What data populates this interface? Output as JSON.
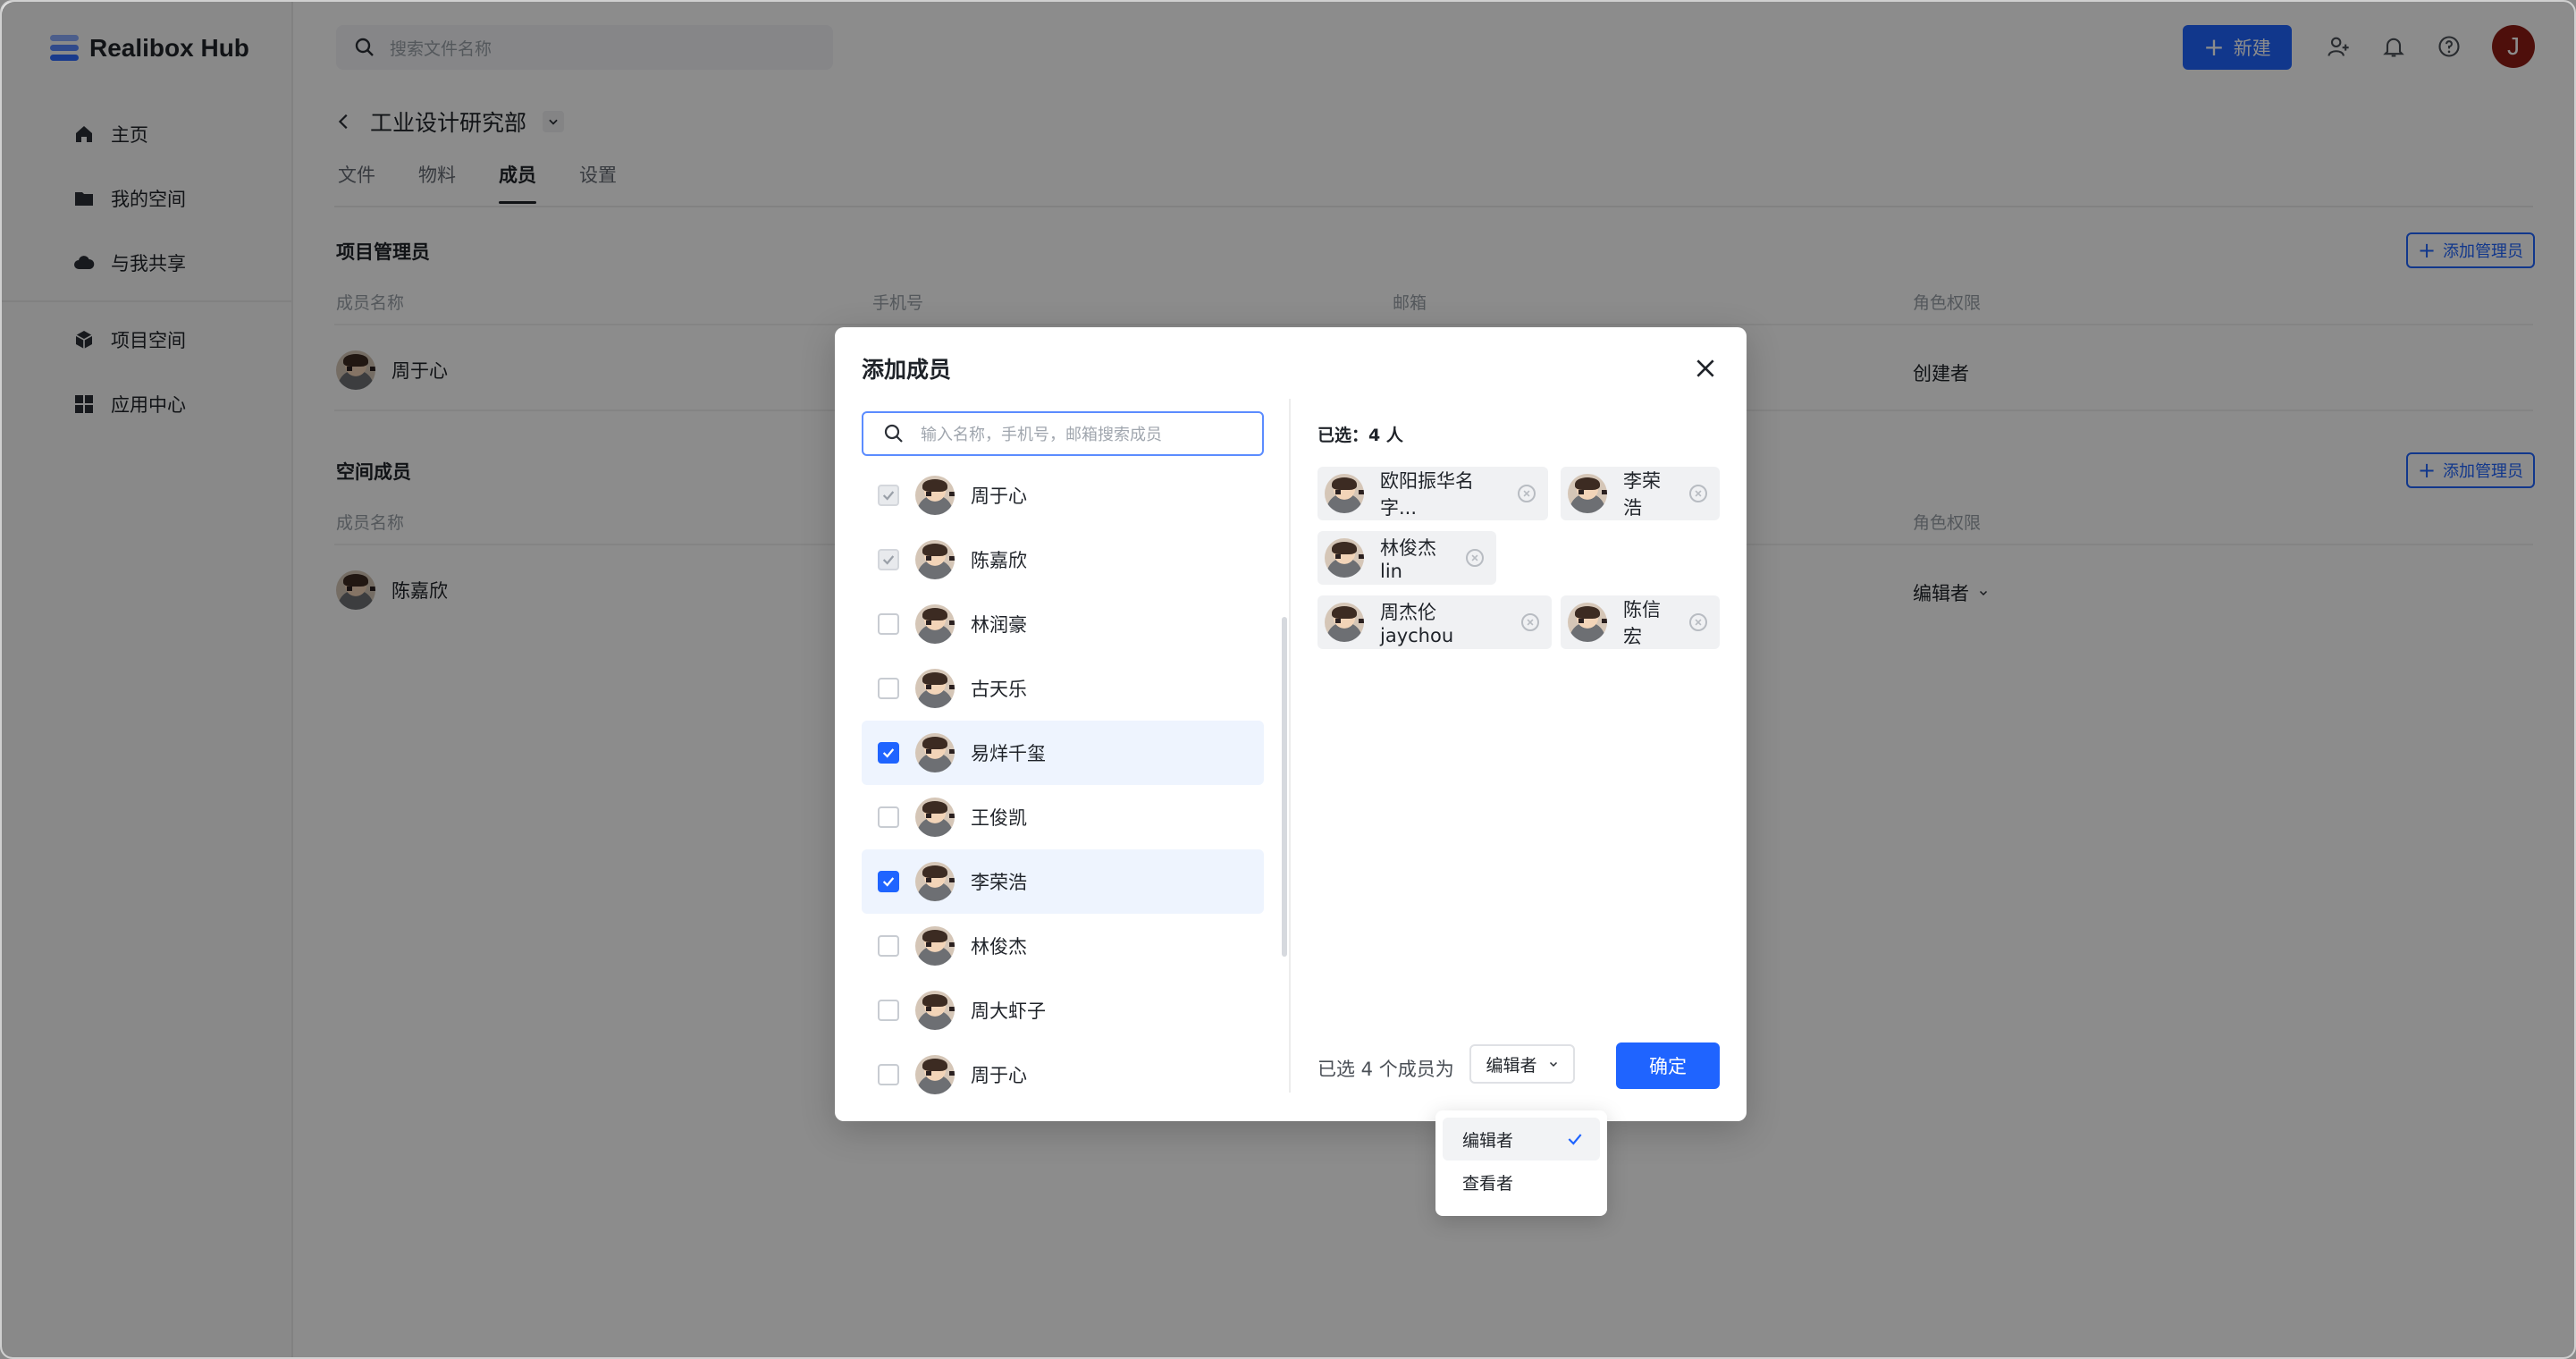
{
  "app": {
    "brand": "Realibox Hub"
  },
  "sidebar": {
    "items": [
      {
        "label": "主页",
        "icon": "home-icon"
      },
      {
        "label": "我的空间",
        "icon": "folder-icon"
      },
      {
        "label": "与我共享",
        "icon": "cloud-icon"
      },
      {
        "label": "项目空间",
        "icon": "cube-icon"
      },
      {
        "label": "应用中心",
        "icon": "grid-icon"
      }
    ]
  },
  "topbar": {
    "search_placeholder": "搜索文件名称",
    "new_button": "新建",
    "avatar_initial": "J"
  },
  "page": {
    "title": "工业设计研究部",
    "tabs": [
      "文件",
      "物料",
      "成员",
      "设置"
    ],
    "active_tab": "成员",
    "admins": {
      "title": "项目管理员",
      "add_button": "添加管理员",
      "columns": [
        "成员名称",
        "手机号",
        "邮箱",
        "角色权限"
      ],
      "rows": [
        {
          "name": "周于心",
          "role": "创建者"
        }
      ]
    },
    "members": {
      "title": "空间成员",
      "add_button": "添加管理员",
      "columns": [
        "成员名称",
        "角色权限"
      ],
      "rows": [
        {
          "name": "陈嘉欣",
          "role": "编辑者"
        }
      ]
    }
  },
  "modal": {
    "title": "添加成员",
    "search_placeholder": "输入名称，手机号，邮箱搜索成员",
    "list": [
      {
        "name": "周于心",
        "state": "disabled"
      },
      {
        "name": "陈嘉欣",
        "state": "disabled"
      },
      {
        "name": "林润豪",
        "state": "off"
      },
      {
        "name": "古天乐",
        "state": "off"
      },
      {
        "name": "易烊千玺",
        "state": "on"
      },
      {
        "name": "王俊凯",
        "state": "off"
      },
      {
        "name": "李荣浩",
        "state": "on"
      },
      {
        "name": "林俊杰",
        "state": "off"
      },
      {
        "name": "周大虾子",
        "state": "off"
      },
      {
        "name": "周于心",
        "state": "off"
      }
    ],
    "selected_title": "已选：4 人",
    "chips": [
      "欧阳振华名字...",
      "李荣浩",
      "林俊杰lin",
      "周杰伦 jaychou",
      "陈信宏"
    ],
    "footer_text": "已选 4 个成员为",
    "role_value": "编辑者",
    "confirm": "确定"
  },
  "dropdown": {
    "options": [
      {
        "label": "编辑者",
        "checked": true
      },
      {
        "label": "查看者",
        "checked": false
      }
    ]
  },
  "colors": {
    "accent": "#1f64ff",
    "avatar_brand": "#8f1c15"
  }
}
